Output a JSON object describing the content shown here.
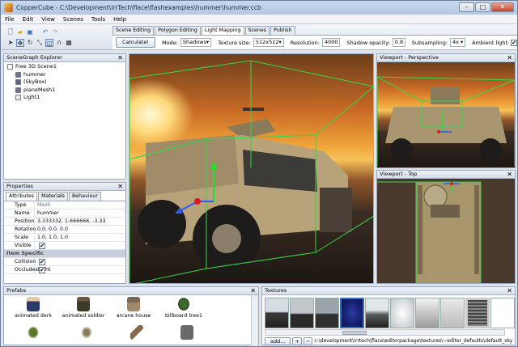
{
  "window": {
    "title": "CopperCube - C:\\Development\\irrTech\\flace\\flashexamples\\hummer\\hummer.ccb",
    "min": "–",
    "max": "□",
    "close": "✕"
  },
  "menu": [
    "File",
    "Edit",
    "View",
    "Scenes",
    "Tools",
    "Help"
  ],
  "tabs": [
    "Scene Editing",
    "Polygon Editing",
    "Light Mapping",
    "Scenes",
    "Publish"
  ],
  "active_tab": "Light Mapping",
  "lightmap": {
    "calculate": "Calculate!",
    "mode_label": "Mode:",
    "mode_value": "Shadows",
    "texsize_label": "Texture size:",
    "texsize_value": "512x512",
    "resolution_label": "Resolution:",
    "resolution_value": "4000",
    "shadow_label": "Shadow opacity:",
    "shadow_value": "0.8",
    "subsampling_label": "Subsampling:",
    "subsampling_value": "4x",
    "ambient_label": "Ambient light:"
  },
  "scenegraph": {
    "title": "SceneGraph Explorer",
    "items": [
      {
        "label": "Free 3D Scene1",
        "indent": 0,
        "color": "#ffffff"
      },
      {
        "label": "hummer",
        "indent": 1,
        "color": "#6a7590"
      },
      {
        "label": "(SkyBox)",
        "indent": 1,
        "color": "#5a6488"
      },
      {
        "label": "planeMesh1",
        "indent": 1,
        "color": "#6a7590"
      },
      {
        "label": "Light1",
        "indent": 1,
        "color": "#e8e8e8"
      }
    ]
  },
  "properties": {
    "title": "Properties",
    "tabs": [
      "Attributes",
      "Materials",
      "Behaviour"
    ],
    "rows": [
      {
        "key": "Type",
        "value": "Mesh",
        "gray": true
      },
      {
        "key": "Name",
        "value": "hummer"
      },
      {
        "key": "Position",
        "value": "3.333332, 1.666666, -3.33"
      },
      {
        "key": "Rotation",
        "value": "0.0, 0.0, 0.0"
      },
      {
        "key": "Scale",
        "value": "1.0, 1.0, 1.0"
      },
      {
        "key": "Visible",
        "value": "✔",
        "check": true
      }
    ],
    "section": "Item Specific",
    "rows2": [
      {
        "key": "Collision",
        "value": "✔",
        "check": true
      },
      {
        "key": "OccludesLight",
        "value": "✔",
        "check": true
      }
    ]
  },
  "viewports": {
    "perspective": "Viewport - Perspective",
    "top": "Viewport - Top"
  },
  "prefabs": {
    "title": "Prefabs",
    "items": [
      "animated derk",
      "animated soldier",
      "arcane house",
      "billboard tree1"
    ]
  },
  "textures": {
    "title": "Textures",
    "add": "add...",
    "plus": "+",
    "minus": "−",
    "path": "c:\\development\\irrtech\\flace\\editorpackage\\textures\\~editor_defaults\\default_skyboxb"
  },
  "colors": {
    "accent": "#3b6fb6",
    "green_box": "#35d84a"
  }
}
